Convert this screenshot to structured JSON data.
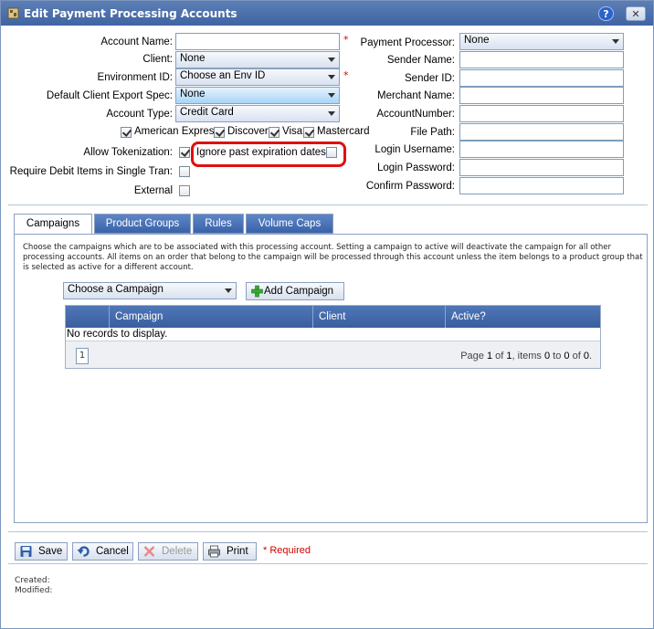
{
  "window": {
    "title": "Edit Payment Processing Accounts",
    "help_label": "?",
    "close_label": "✕"
  },
  "left_form": {
    "account_name_label": "Account Name:",
    "account_name_value": "",
    "client_label": "Client:",
    "client_value": "None",
    "environment_label": "Environment ID:",
    "environment_value": "Choose an Env ID",
    "export_spec_label": "Default Client Export Spec:",
    "export_spec_value": "None",
    "account_type_label": "Account Type:",
    "account_type_value": "Credit Card",
    "card_types": [
      {
        "label": "American Express",
        "checked": true
      },
      {
        "label": "Discover",
        "checked": true
      },
      {
        "label": "Visa",
        "checked": true
      },
      {
        "label": "Mastercard",
        "checked": true
      }
    ],
    "allow_tokenization_label": "Allow Tokenization:",
    "allow_tokenization_checked": true,
    "ignore_expiration_label": "Ignore past expiration dates:",
    "ignore_expiration_checked": false,
    "require_debit_label": "Require Debit Items in Single Tran:",
    "require_debit_checked": false,
    "external_label": "External",
    "external_checked": false,
    "required_star": "*"
  },
  "right_form": {
    "payment_processor_label": "Payment Processor:",
    "payment_processor_value": "None",
    "sender_name_label": "Sender Name:",
    "sender_id_label": "Sender ID:",
    "merchant_name_label": "Merchant Name:",
    "account_number_label": "AccountNumber:",
    "file_path_label": "File Path:",
    "login_username_label": "Login Username:",
    "login_password_label": "Login Password:",
    "confirm_password_label": "Confirm Password:"
  },
  "tabs": [
    {
      "label": "Campaigns",
      "active": true
    },
    {
      "label": "Product Groups",
      "active": false
    },
    {
      "label": "Rules",
      "active": false
    },
    {
      "label": "Volume Caps",
      "active": false
    }
  ],
  "campaigns": {
    "description": "Choose the campaigns which are to be associated with this processing account. Setting a campaign to active will deactivate the campaign for all other processing accounts. All items on an order that belong to the campaign will be processed through this account unless the item belongs to a product group that is selected as active for a different account.",
    "choose_placeholder": "Choose a Campaign",
    "add_button": "Add Campaign",
    "columns": [
      "Campaign",
      "Client",
      "Active?"
    ],
    "empty_text": "No records to display.",
    "page_number": "1",
    "pager": {
      "prefix": "Page ",
      "page": "1",
      "of": " of ",
      "pages": "1",
      "items": ", items ",
      "from": "0",
      "to": " to ",
      "to_val": "0",
      "of2": " of ",
      "total": "0",
      "end": "."
    }
  },
  "footer": {
    "save_label": "Save",
    "cancel_label": "Cancel",
    "delete_label": "Delete",
    "print_label": "Print",
    "required_note": "* Required",
    "created_label": "Created:",
    "modified_label": "Modified:"
  },
  "colors": {
    "title_bar": "#4a6fae",
    "tab_inactive": "#4a72b5",
    "required": "#e00000",
    "highlight": "#e01010"
  }
}
